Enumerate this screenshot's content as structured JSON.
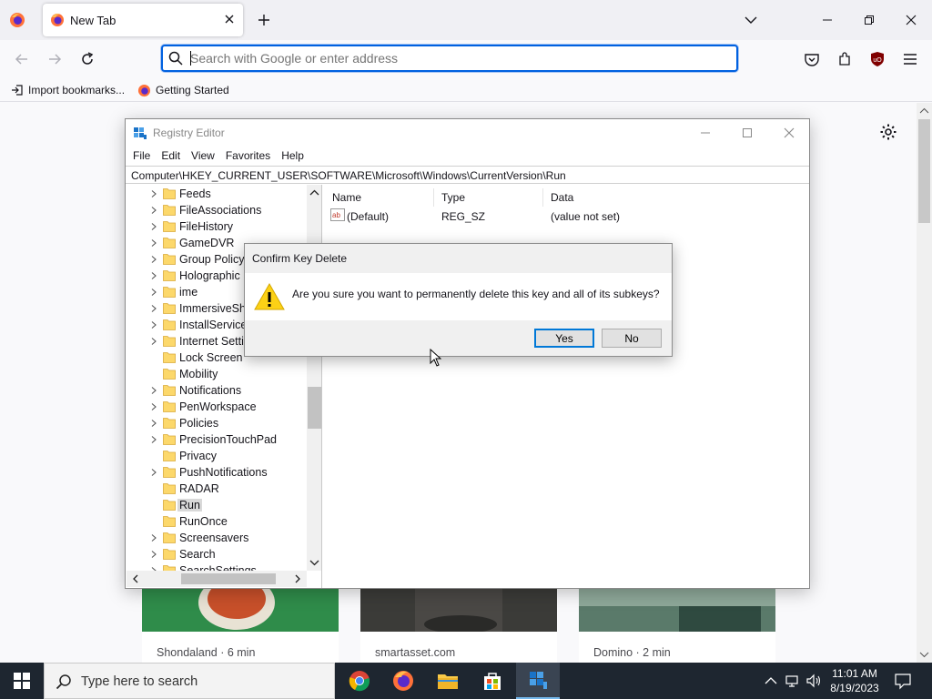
{
  "browser": {
    "tab_title": "New Tab",
    "url_placeholder": "Search with Google or enter address",
    "bookmarks": [
      "Import bookmarks...",
      "Getting Started"
    ]
  },
  "newtab": {
    "cards": [
      {
        "source": "Shondaland · 6 min"
      },
      {
        "source": "smartasset.com"
      },
      {
        "source": "Domino · 2 min"
      }
    ]
  },
  "regedit": {
    "title": "Registry Editor",
    "menu": [
      "File",
      "Edit",
      "View",
      "Favorites",
      "Help"
    ],
    "address": "Computer\\HKEY_CURRENT_USER\\SOFTWARE\\Microsoft\\Windows\\CurrentVersion\\Run",
    "tree": [
      {
        "label": "Feeds",
        "expandable": true
      },
      {
        "label": "FileAssociations",
        "expandable": true
      },
      {
        "label": "FileHistory",
        "expandable": true
      },
      {
        "label": "GameDVR",
        "expandable": true
      },
      {
        "label": "Group Policy",
        "expandable": true
      },
      {
        "label": "Holographic",
        "expandable": true
      },
      {
        "label": "ime",
        "expandable": true
      },
      {
        "label": "ImmersiveShe",
        "expandable": true
      },
      {
        "label": "InstallService",
        "expandable": true
      },
      {
        "label": "Internet Settin",
        "expandable": true
      },
      {
        "label": "Lock Screen",
        "expandable": false
      },
      {
        "label": "Mobility",
        "expandable": false
      },
      {
        "label": "Notifications",
        "expandable": true
      },
      {
        "label": "PenWorkspace",
        "expandable": true
      },
      {
        "label": "Policies",
        "expandable": true
      },
      {
        "label": "PrecisionTouchPad",
        "expandable": true
      },
      {
        "label": "Privacy",
        "expandable": false
      },
      {
        "label": "PushNotifications",
        "expandable": true
      },
      {
        "label": "RADAR",
        "expandable": false
      },
      {
        "label": "Run",
        "expandable": false,
        "selected": true
      },
      {
        "label": "RunOnce",
        "expandable": false
      },
      {
        "label": "Screensavers",
        "expandable": true
      },
      {
        "label": "Search",
        "expandable": true
      },
      {
        "label": "SearchSettings",
        "expandable": true
      }
    ],
    "columns": [
      "Name",
      "Type",
      "Data"
    ],
    "values": [
      {
        "name": "(Default)",
        "type": "REG_SZ",
        "data": "(value not set)"
      }
    ]
  },
  "dialog": {
    "title": "Confirm Key Delete",
    "message": "Are you sure you want to permanently delete this key and all of its subkeys?",
    "yes": "Yes",
    "no": "No"
  },
  "taskbar": {
    "search_placeholder": "Type here to search",
    "time": "11:01 AM",
    "date": "8/19/2023"
  }
}
